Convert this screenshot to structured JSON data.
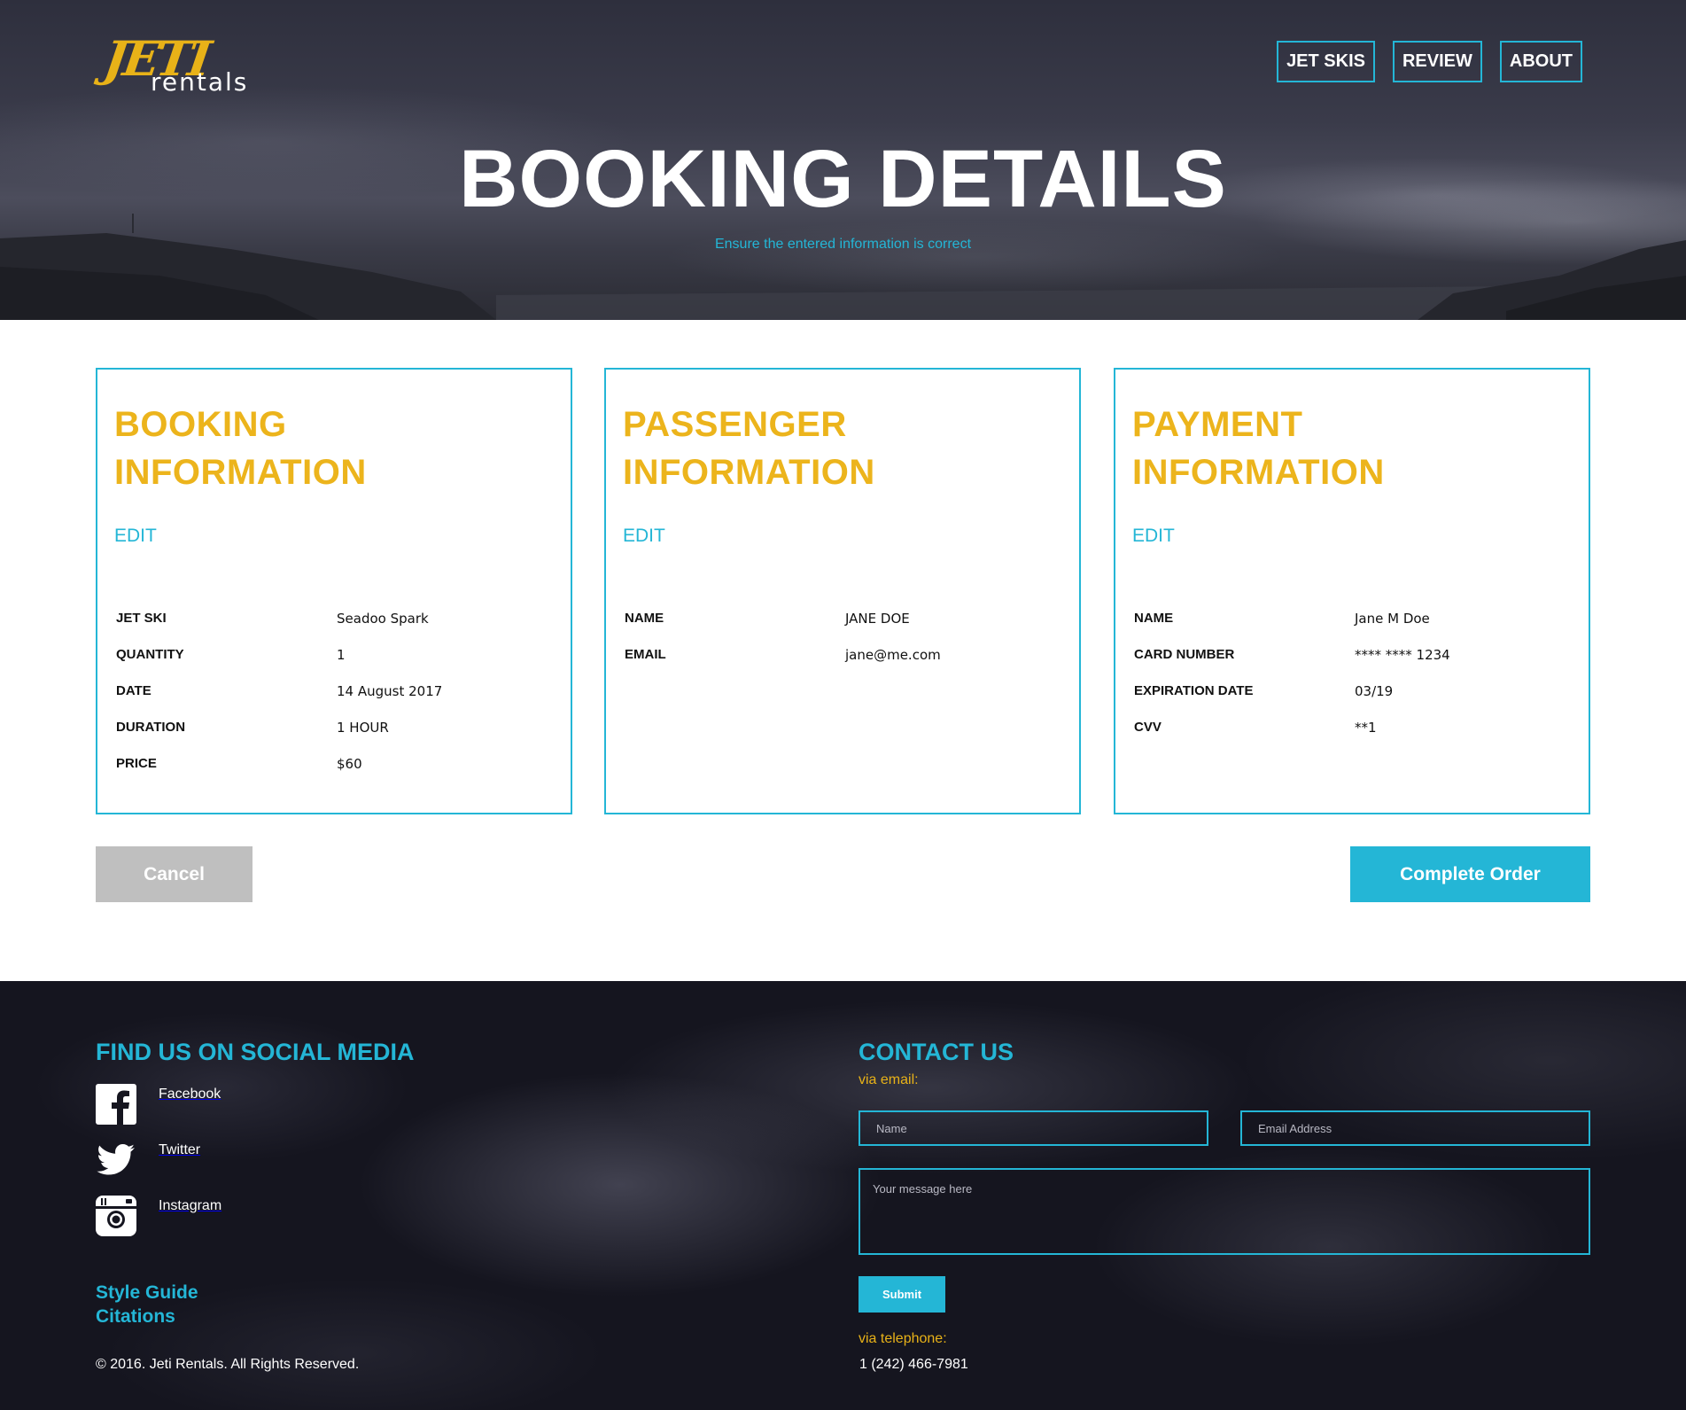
{
  "header": {
    "logo": {
      "mark": "JETI",
      "word": "rentals"
    },
    "nav": [
      "JET SKIS",
      "REVIEW",
      "ABOUT"
    ],
    "title": "BOOKING DETAILS",
    "subtitle": "Ensure the entered information is correct"
  },
  "cards": [
    {
      "title_line1": "BOOKING",
      "title_line2": "INFORMATION",
      "edit_label": "EDIT",
      "rows": [
        {
          "label": "JET SKI",
          "value": "Seadoo Spark"
        },
        {
          "label": "QUANTITY",
          "value": "1"
        },
        {
          "label": "DATE",
          "value": "14 August 2017"
        },
        {
          "label": "DURATION",
          "value": "1 HOUR"
        },
        {
          "label": "PRICE",
          "value": "$60"
        }
      ]
    },
    {
      "title_line1": "PASSENGER",
      "title_line2": "INFORMATION",
      "edit_label": "EDIT",
      "rows": [
        {
          "label": "NAME",
          "value": "JANE DOE"
        },
        {
          "label": "EMAIL",
          "value": "jane@me.com"
        }
      ]
    },
    {
      "title_line1": "PAYMENT",
      "title_line2": "INFORMATION",
      "edit_label": "EDIT",
      "rows": [
        {
          "label": "NAME",
          "value": "Jane M Doe"
        },
        {
          "label": "CARD NUMBER",
          "value": "**** **** 1234"
        },
        {
          "label": "EXPIRATION DATE",
          "value": "03/19"
        },
        {
          "label": "CVV",
          "value": "**1"
        }
      ]
    }
  ],
  "actions": {
    "cancel": "Cancel",
    "complete": "Complete Order"
  },
  "footer": {
    "social_heading": "FIND US ON SOCIAL MEDIA",
    "social": [
      {
        "icon": "facebook-icon",
        "label": "Facebook"
      },
      {
        "icon": "twitter-icon",
        "label": "Twitter"
      },
      {
        "icon": "instagram-icon",
        "label": "Instagram"
      }
    ],
    "links": [
      "Style Guide",
      "Citations"
    ],
    "copyright": "© 2016. Jeti Rentals. All Rights Reserved.",
    "contact_heading": "CONTACT US",
    "via_email": "via email:",
    "name_placeholder": "Name",
    "email_placeholder": "Email Address",
    "message_placeholder": "Your message here",
    "submit": "Submit",
    "via_phone": "via telephone:",
    "phone": "1 (242) 466-7981"
  },
  "colors": {
    "accent": "#24b6d6",
    "gold": "#ecb41c",
    "cancel": "#bfbfbf"
  }
}
